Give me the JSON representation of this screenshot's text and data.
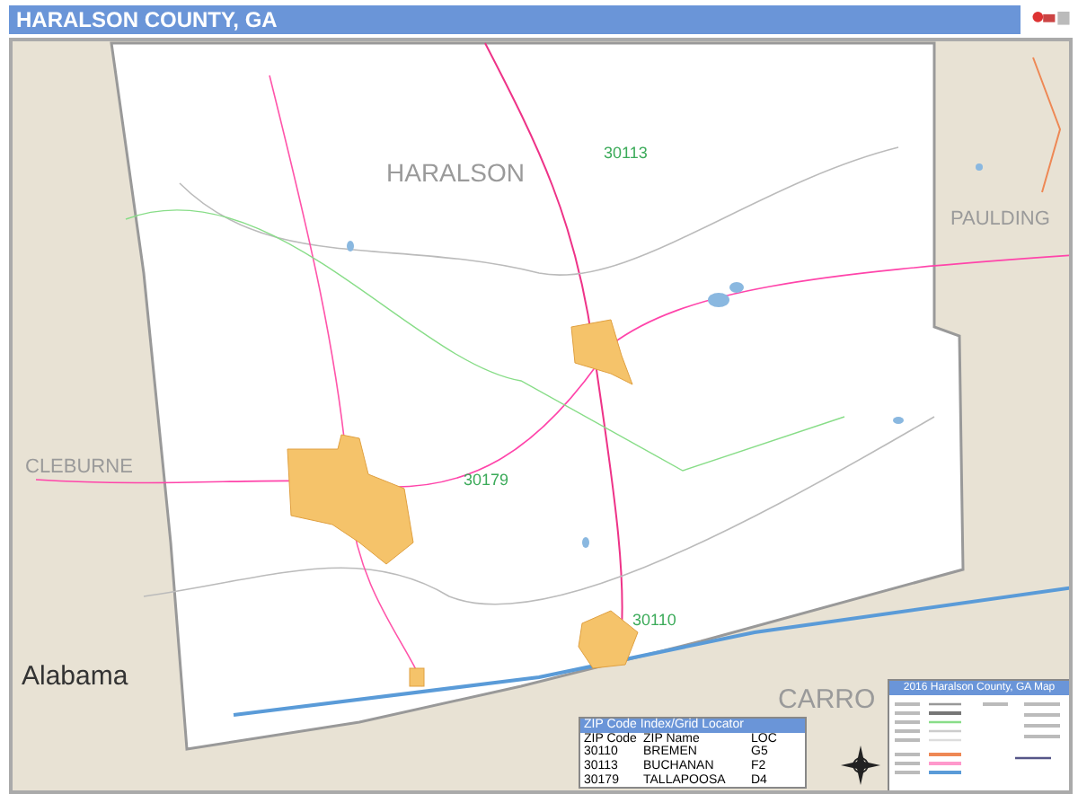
{
  "header": {
    "title": "HARALSON COUNTY, GA"
  },
  "map": {
    "county_labels": [
      "HARALSON",
      "PAULDING",
      "CLEBURNE",
      "CARRO"
    ],
    "state_label": "Alabama",
    "zip_labels": [
      "30113",
      "30179",
      "30110"
    ]
  },
  "legend": {
    "title": "2016 Haralson County, GA Map"
  },
  "zip_index": {
    "title": "ZIP Code Index/Grid Locator",
    "columns": [
      "ZIP Code",
      "ZIP Name",
      "LOC"
    ],
    "rows": [
      [
        "30110",
        "BREMEN",
        "G5"
      ],
      [
        "30113",
        "BUCHANAN",
        "F2"
      ],
      [
        "30179",
        "TALLAPOOSA",
        "D4"
      ]
    ]
  }
}
